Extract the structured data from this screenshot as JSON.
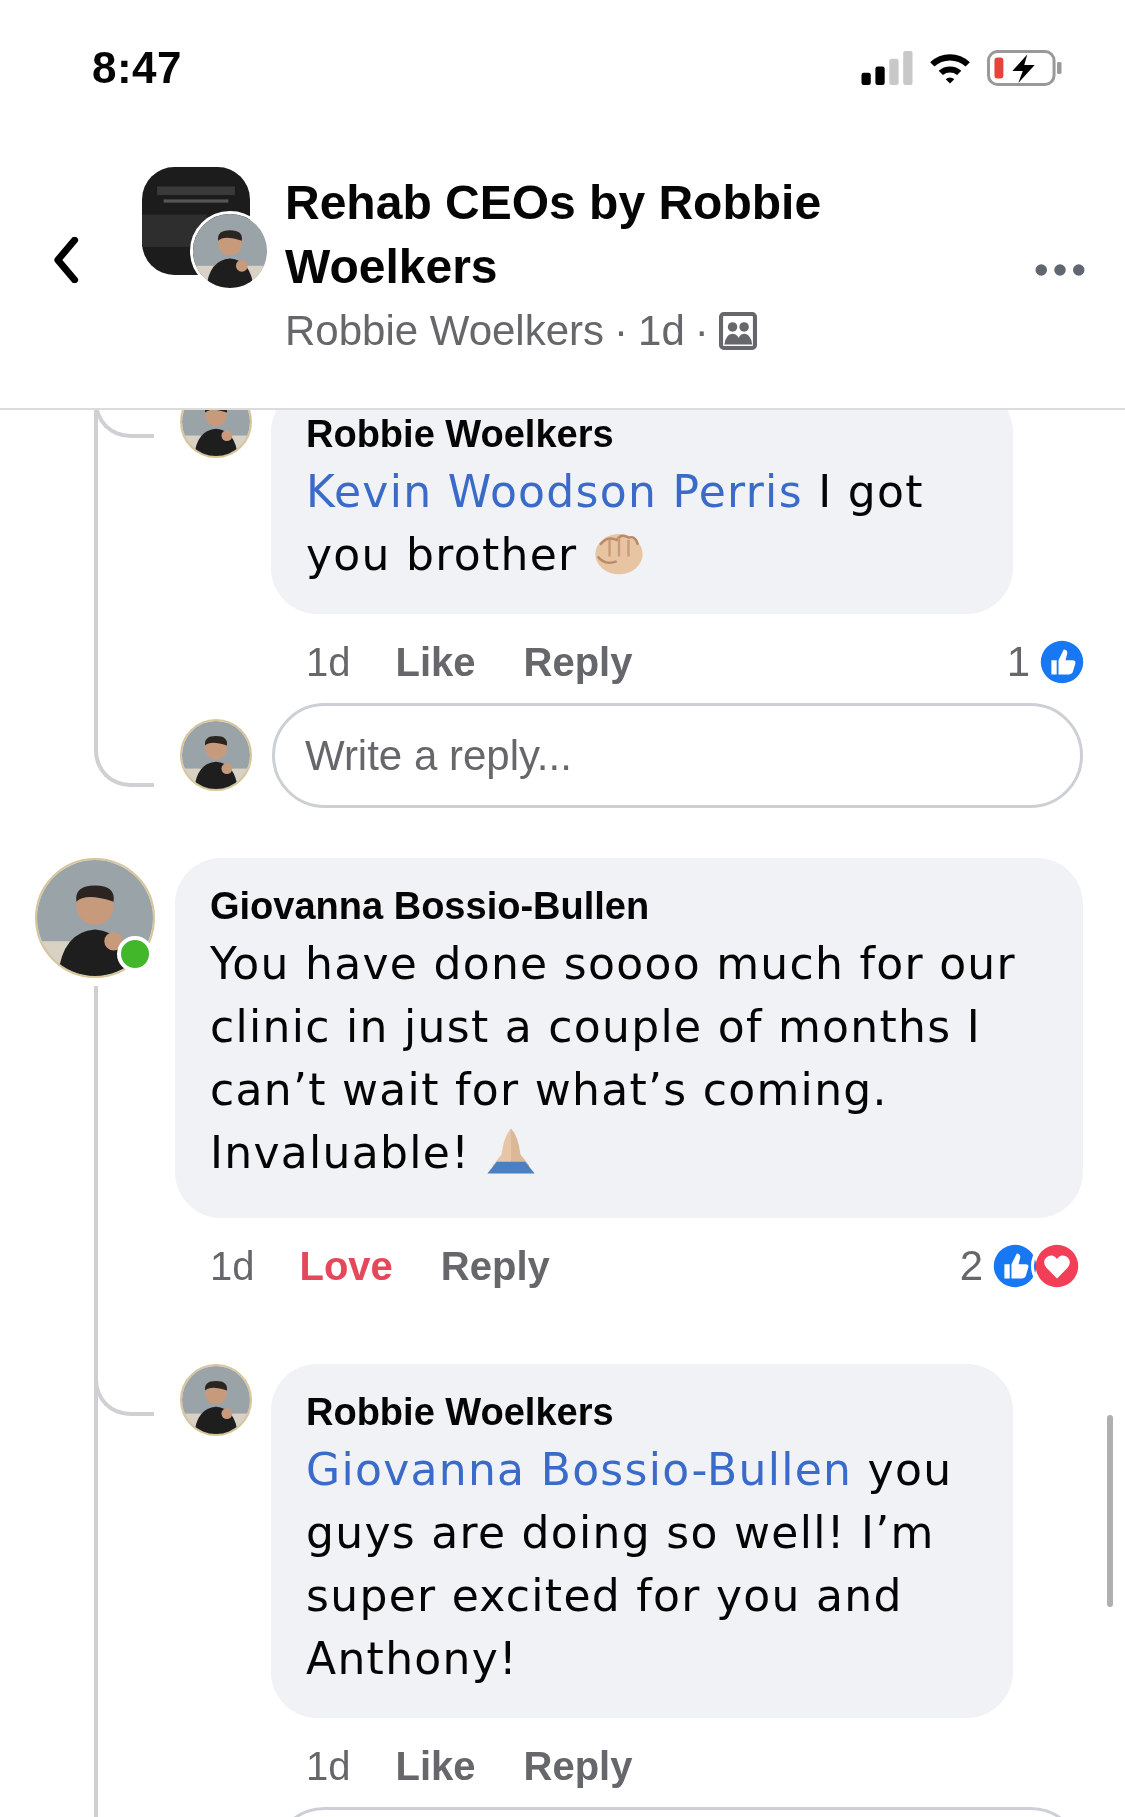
{
  "status_bar": {
    "time": "8:47"
  },
  "header": {
    "title": "Rehab CEOs by Robbie Woelkers",
    "author": "Robbie Woelkers",
    "separator": "·",
    "age": "1d"
  },
  "thread": [
    {
      "kind": "reply",
      "author": "Robbie Woelkers",
      "mention": "Kevin Woodson Perris",
      "text": " I got you brother",
      "emoji": {
        "kind": "fist"
      },
      "time": "1d",
      "actions": [
        {
          "label": "Like",
          "reacted": false
        },
        {
          "label": "Reply",
          "reacted": false
        }
      ],
      "reaction_count": "1",
      "liked": true,
      "loved": false
    },
    {
      "kind": "reply_field",
      "placeholder": "Write a reply..."
    },
    {
      "kind": "comment",
      "author": "Giovanna Bossio-Bullen",
      "online": true,
      "text": "You have done soooo much for our clinic in just a couple of months I can’t wait for what’s coming. Invaluable!",
      "emoji": {
        "kind": "folded-hands"
      },
      "time": "1d",
      "actions": [
        {
          "label": "Love",
          "reacted": true
        },
        {
          "label": "Reply",
          "reacted": false
        }
      ],
      "reaction_count": "2",
      "liked": true,
      "loved": true
    },
    {
      "kind": "reply",
      "author": "Robbie Woelkers",
      "mention": "Giovanna Bossio-Bullen",
      "text": " you guys are doing so well! I’m super excited for you and Anthony!",
      "time": "1d",
      "actions": [
        {
          "label": "Like",
          "reacted": false
        },
        {
          "label": "Reply",
          "reacted": false
        }
      ]
    },
    {
      "kind": "reply_field"
    }
  ]
}
